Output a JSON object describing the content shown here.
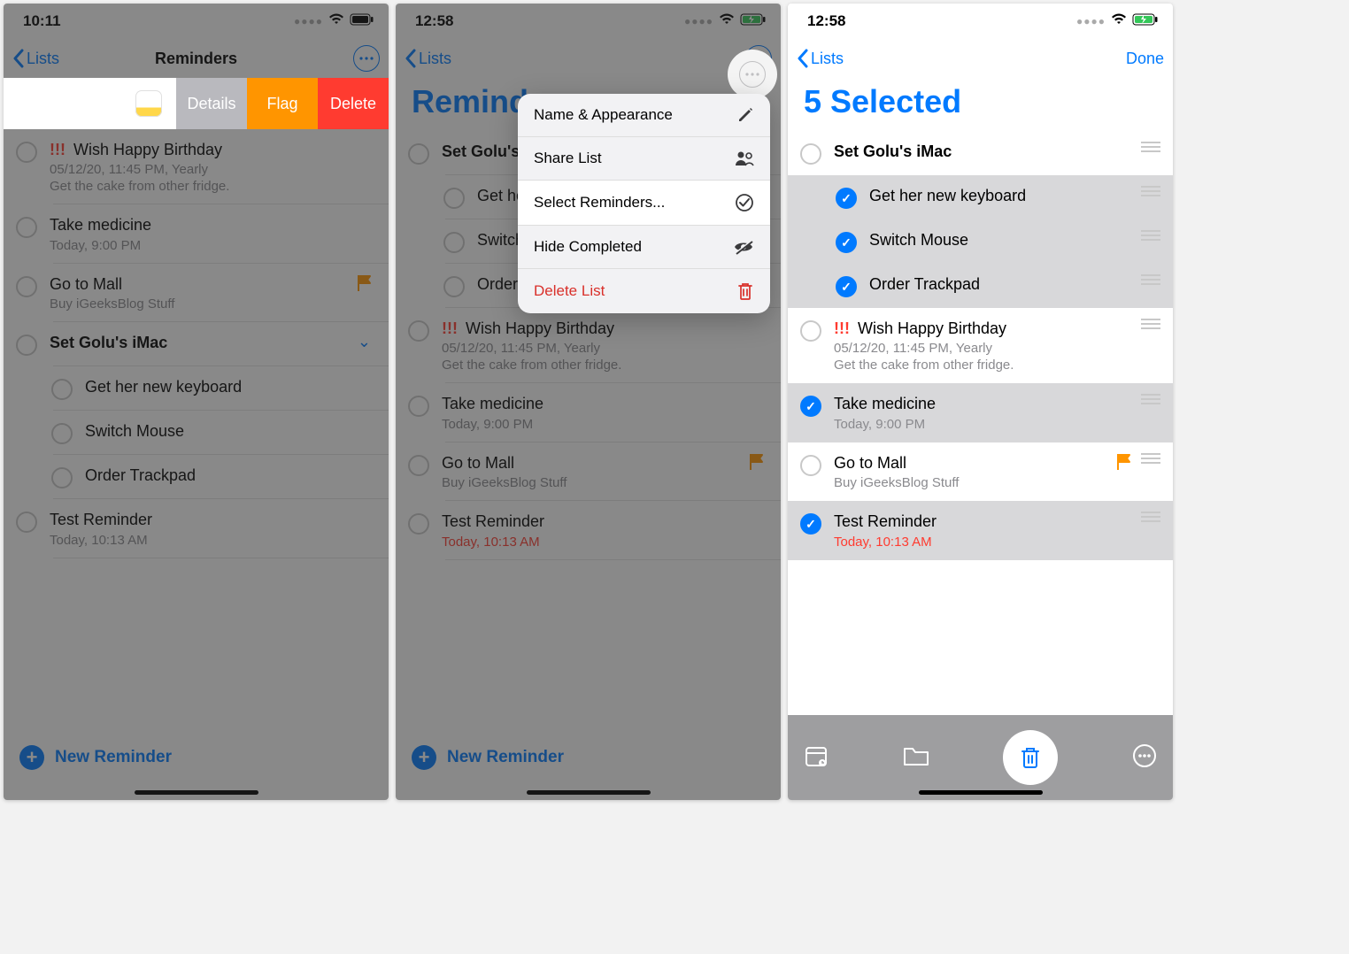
{
  "screen1": {
    "time": "10:11",
    "back": "Lists",
    "title": "Reminders",
    "swipe": {
      "details": "Details",
      "flag": "Flag",
      "delete": "Delete"
    },
    "rows": [
      {
        "priority": "!!!",
        "title": "Wish Happy Birthday",
        "sub": "05/12/20, 11:45 PM, Yearly",
        "note": "Get the cake from other fridge."
      },
      {
        "title": "Take medicine",
        "sub": "Today, 9:00 PM"
      },
      {
        "title": "Go to Mall",
        "note": "Buy iGeeksBlog Stuff",
        "flagged": true
      },
      {
        "title": "Set Golu's iMac",
        "bold": true,
        "expand": true
      },
      {
        "title": "Get her new keyboard",
        "sub_item": true
      },
      {
        "title": "Switch Mouse",
        "sub_item": true
      },
      {
        "title": "Order Trackpad",
        "sub_item": true
      },
      {
        "title": "Test Reminder",
        "sub": "Today, 10:13 AM"
      }
    ],
    "new_btn": "New Reminder"
  },
  "screen2": {
    "time": "12:58",
    "back": "Lists",
    "big_title": "Reminders",
    "menu": {
      "name_appearance": "Name & Appearance",
      "share_list": "Share List",
      "select_reminders": "Select Reminders...",
      "hide_completed": "Hide Completed",
      "delete_list": "Delete List"
    },
    "rows": [
      {
        "title": "Set Golu's iMac",
        "bold": true
      },
      {
        "title": "Get her new keyboard",
        "sub_item": true
      },
      {
        "title": "Switch Mouse",
        "sub_item": true
      },
      {
        "title": "Order Trackpad",
        "sub_item": true
      },
      {
        "priority": "!!!",
        "title": "Wish Happy Birthday",
        "sub": "05/12/20, 11:45 PM, Yearly",
        "note": "Get the cake from other fridge."
      },
      {
        "title": "Take medicine",
        "sub": "Today, 9:00 PM"
      },
      {
        "title": "Go to Mall",
        "note": "Buy iGeeksBlog Stuff",
        "flagged": true
      },
      {
        "title": "Test Reminder",
        "sub": "Today, 10:13 AM",
        "red": true
      }
    ],
    "new_btn": "New Reminder"
  },
  "screen3": {
    "time": "12:58",
    "back": "Lists",
    "done": "Done",
    "selected_title": "5 Selected",
    "rows": [
      {
        "title": "Set Golu's iMac",
        "parent": true,
        "selected": false
      },
      {
        "title": "Get her new keyboard",
        "child": true,
        "selected": true
      },
      {
        "title": "Switch Mouse",
        "child": true,
        "selected": true
      },
      {
        "title": "Order Trackpad",
        "child": true,
        "selected": true
      },
      {
        "priority": "!!!",
        "title": "Wish Happy Birthday",
        "sub": "05/12/20, 11:45 PM, Yearly",
        "note": "Get the cake from other fridge.",
        "selected": false
      },
      {
        "title": "Take medicine",
        "sub": "Today, 9:00 PM",
        "selected": true
      },
      {
        "title": "Go to Mall",
        "note": "Buy iGeeksBlog Stuff",
        "flagged": true,
        "selected": false
      },
      {
        "title": "Test Reminder",
        "sub": "Today, 10:13 AM",
        "red": true,
        "selected": true
      }
    ]
  }
}
